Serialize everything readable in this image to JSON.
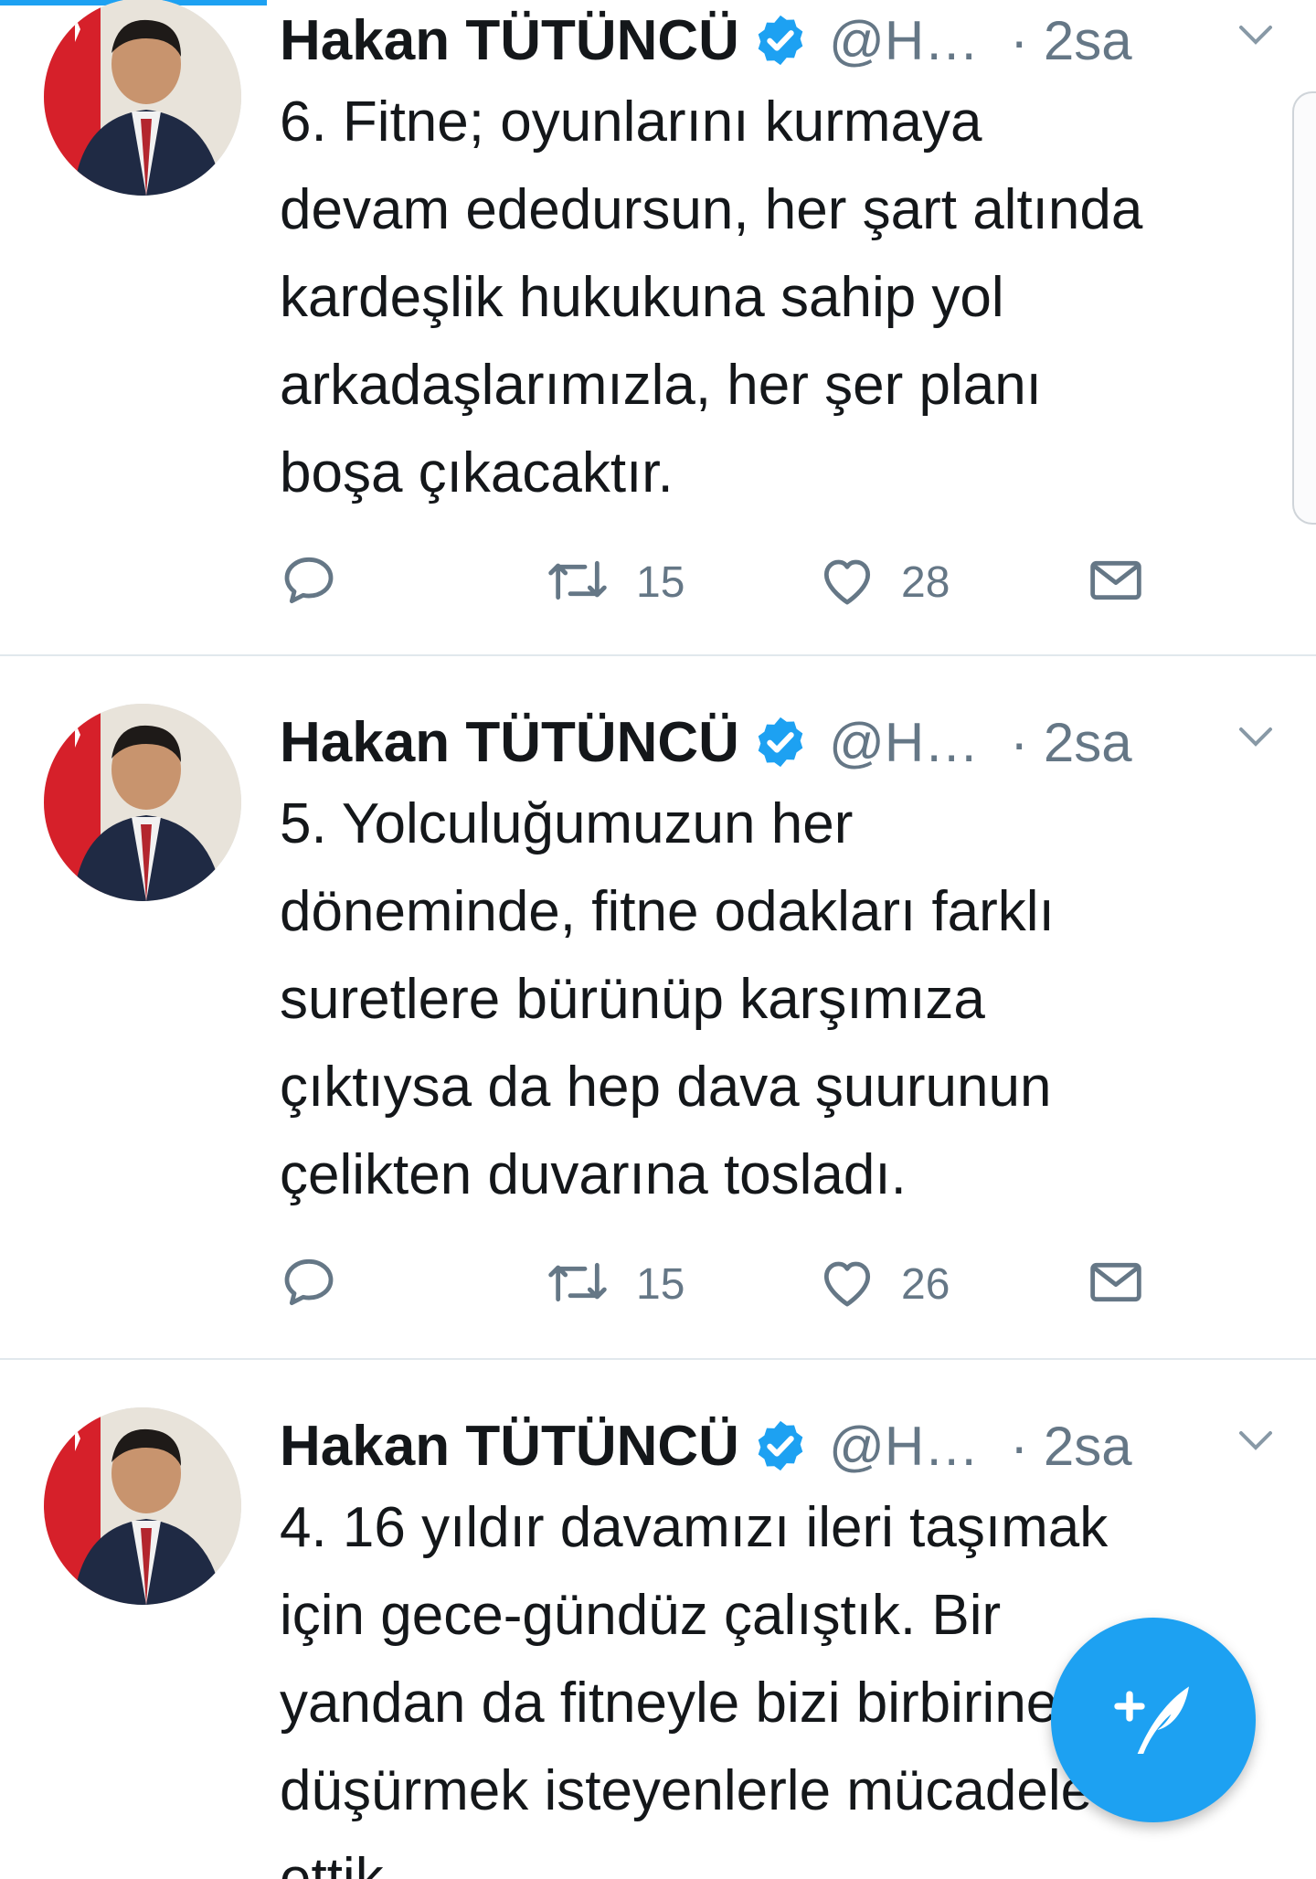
{
  "tweets": [
    {
      "author_name": "Hakan TÜTÜNCÜ",
      "handle": "@H…",
      "time": "· 2sa",
      "text": "6. Fitne; oyunlarını kurmaya\ndevam ededursun, her şart altında\nkardeşlik hukukuna sahip yol\narkadaşlarımızla, her şer planı\nboşa çıkacaktır.",
      "retweets": "15",
      "likes": "28"
    },
    {
      "author_name": "Hakan TÜTÜNCÜ",
      "handle": "@H…",
      "time": "· 2sa",
      "text": "5. Yolculuğumuzun her\ndöneminde, fitne odakları farklı\nsuretlere bürünüp karşımıza\nçıktıysa da hep dava şuurunun\nçelikten duvarına tosladı.",
      "retweets": "15",
      "likes": "26"
    },
    {
      "author_name": "Hakan TÜTÜNCÜ",
      "handle": "@H…",
      "time": "· 2sa",
      "text": "4. 16 yıldır davamızı ileri taşımak\niçin gece-gündüz çalıştık. Bir\nyandan da fitneyle bizi birbirine\ndüşürmek isteyenlerle mücadele\nettik."
    }
  ],
  "icons": {
    "reply": "reply-icon",
    "retweet": "retweet-icon",
    "like": "heart-icon",
    "dm": "envelope-icon",
    "verified": "verified-badge-icon",
    "caret": "chevron-down-icon",
    "compose": "compose-tweet-icon"
  },
  "colors": {
    "accent": "#1da1f2",
    "text": "#14171a",
    "secondary": "#657786",
    "divider": "#e1e8ed"
  }
}
